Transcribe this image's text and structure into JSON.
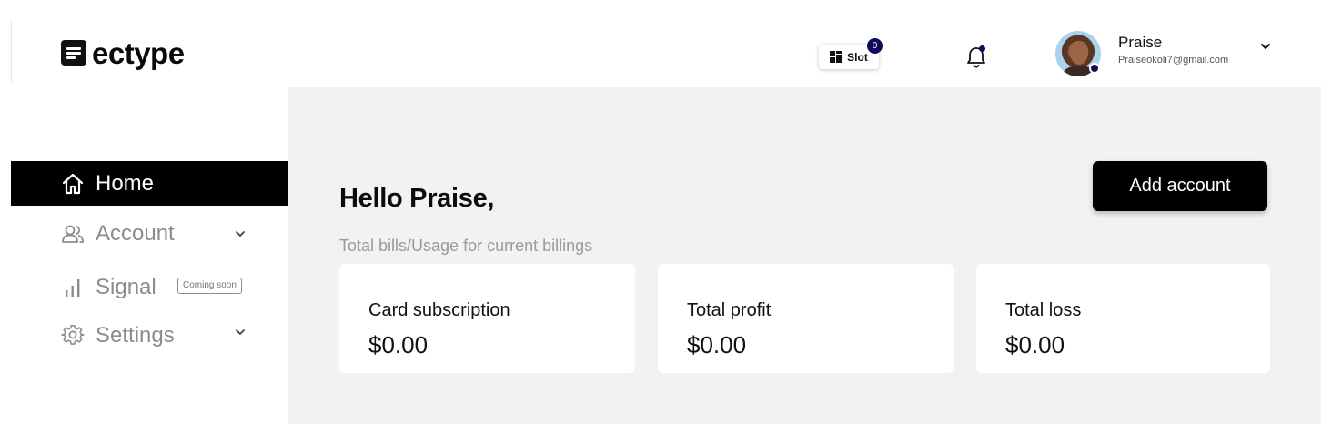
{
  "brand": {
    "name": "ectype"
  },
  "header": {
    "slot": {
      "label": "Slot",
      "count": "0"
    },
    "user": {
      "name": "Praise",
      "email": "Praiseokoli7@gmail.com"
    }
  },
  "sidebar": {
    "items": [
      {
        "label": "Home",
        "icon": "home-icon",
        "active": true
      },
      {
        "label": "Account",
        "icon": "users-icon",
        "has_caret": true
      },
      {
        "label": "Signal",
        "icon": "signal-icon",
        "badge": "Coming soon"
      },
      {
        "label": "Settings",
        "icon": "gear-icon",
        "has_caret": true
      }
    ]
  },
  "main": {
    "greeting": "Hello Praise,",
    "subtitle": "Total bills/Usage for current billings",
    "add_button": "Add account",
    "cards": [
      {
        "title": "Card subscription",
        "value": "$0.00"
      },
      {
        "title": "Total profit",
        "value": "$0.00"
      },
      {
        "title": "Total loss",
        "value": "$0.00"
      }
    ]
  },
  "colors": {
    "accent": "#0f0a5c",
    "active_nav_bg": "#000000",
    "main_bg": "#f2f2f2",
    "muted_text": "#8c8c8c"
  }
}
